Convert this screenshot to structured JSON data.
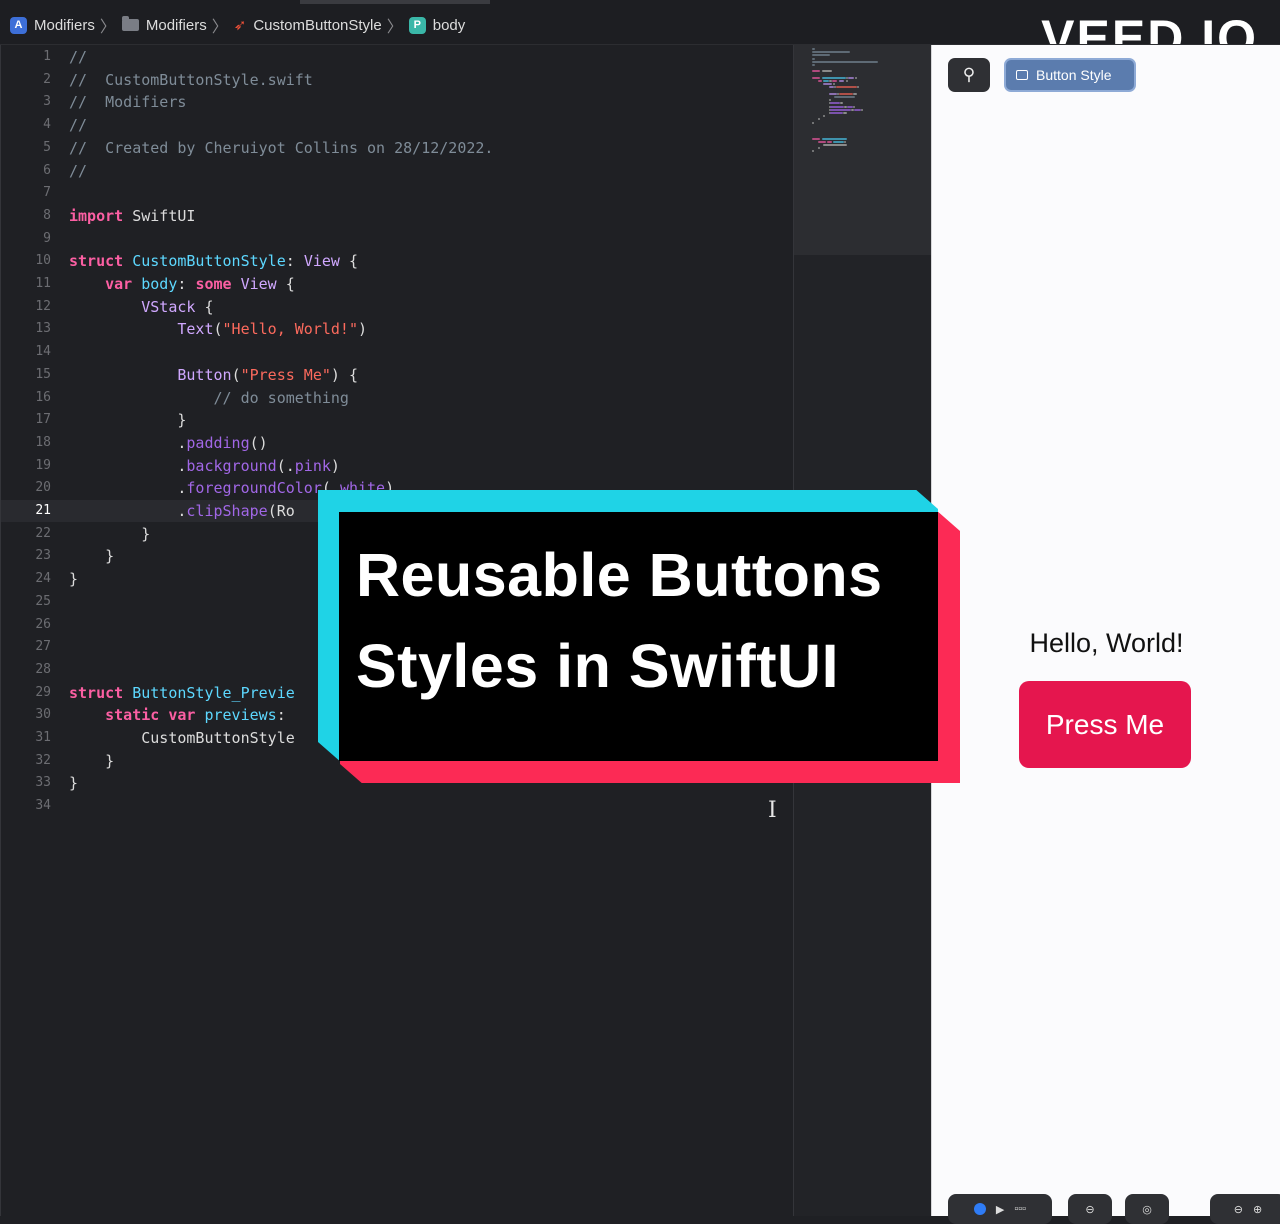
{
  "breadcrumb": {
    "items": [
      {
        "label": "Modifiers",
        "icon": "app-icon"
      },
      {
        "label": "Modifiers",
        "icon": "folder-icon"
      },
      {
        "label": "CustomButtonStyle",
        "icon": "swift-icon"
      },
      {
        "label": "body",
        "icon": "property-icon",
        "icon_letter": "P"
      }
    ]
  },
  "watermark": "VEED.IO",
  "editor": {
    "current_line": 21,
    "lines": [
      {
        "n": "1",
        "t": [
          [
            "c-com",
            "//"
          ]
        ]
      },
      {
        "n": "2",
        "t": [
          [
            "c-com",
            "//  CustomButtonStyle.swift"
          ]
        ]
      },
      {
        "n": "3",
        "t": [
          [
            "c-com",
            "//  Modifiers"
          ]
        ]
      },
      {
        "n": "4",
        "t": [
          [
            "c-com",
            "//"
          ]
        ]
      },
      {
        "n": "5",
        "t": [
          [
            "c-com",
            "//  Created by Cheruiyot Collins on 28/12/2022."
          ]
        ]
      },
      {
        "n": "6",
        "t": [
          [
            "c-com",
            "//"
          ]
        ]
      },
      {
        "n": "7",
        "t": []
      },
      {
        "n": "8",
        "t": [
          [
            "c-kw",
            "import"
          ],
          [
            "c-plain",
            " SwiftUI"
          ]
        ]
      },
      {
        "n": "9",
        "t": []
      },
      {
        "n": "10",
        "t": [
          [
            "c-kw",
            "struct"
          ],
          [
            "c-plain",
            " "
          ],
          [
            "c-type",
            "CustomButtonStyle"
          ],
          [
            "c-plain",
            ": "
          ],
          [
            "c-ty2",
            "View"
          ],
          [
            "c-plain",
            " {"
          ]
        ]
      },
      {
        "n": "11",
        "t": [
          [
            "c-plain",
            "    "
          ],
          [
            "c-kw",
            "var"
          ],
          [
            "c-plain",
            " "
          ],
          [
            "c-type",
            "body"
          ],
          [
            "c-plain",
            ": "
          ],
          [
            "c-kw",
            "some"
          ],
          [
            "c-plain",
            " "
          ],
          [
            "c-ty2",
            "View"
          ],
          [
            "c-plain",
            " {"
          ]
        ]
      },
      {
        "n": "12",
        "t": [
          [
            "c-plain",
            "        "
          ],
          [
            "c-ty2",
            "VStack"
          ],
          [
            "c-plain",
            " {"
          ]
        ]
      },
      {
        "n": "13",
        "t": [
          [
            "c-plain",
            "            "
          ],
          [
            "c-ty2",
            "Text"
          ],
          [
            "c-plain",
            "("
          ],
          [
            "c-str",
            "\"Hello, World!\""
          ],
          [
            "c-plain",
            ")"
          ]
        ]
      },
      {
        "n": "14",
        "t": []
      },
      {
        "n": "15",
        "t": [
          [
            "c-plain",
            "            "
          ],
          [
            "c-ty2",
            "Button"
          ],
          [
            "c-plain",
            "("
          ],
          [
            "c-str",
            "\"Press Me\""
          ],
          [
            "c-plain",
            ") {"
          ]
        ]
      },
      {
        "n": "16",
        "t": [
          [
            "c-plain",
            "                "
          ],
          [
            "c-com",
            "// do something"
          ]
        ]
      },
      {
        "n": "17",
        "t": [
          [
            "c-plain",
            "            }"
          ]
        ]
      },
      {
        "n": "18",
        "t": [
          [
            "c-plain",
            "            ."
          ],
          [
            "c-fn",
            "padding"
          ],
          [
            "c-plain",
            "()"
          ]
        ]
      },
      {
        "n": "19",
        "t": [
          [
            "c-plain",
            "            ."
          ],
          [
            "c-fn",
            "background"
          ],
          [
            "c-plain",
            "(."
          ],
          [
            "c-fn",
            "pink"
          ],
          [
            "c-plain",
            ")"
          ]
        ]
      },
      {
        "n": "20",
        "t": [
          [
            "c-plain",
            "            ."
          ],
          [
            "c-fn",
            "foregroundColor"
          ],
          [
            "c-plain",
            "(."
          ],
          [
            "c-fn",
            "white"
          ],
          [
            "c-plain",
            ")"
          ]
        ]
      },
      {
        "n": "21",
        "t": [
          [
            "c-plain",
            "            ."
          ],
          [
            "c-fn",
            "clipShape"
          ],
          [
            "c-plain",
            "(Ro"
          ]
        ]
      },
      {
        "n": "22",
        "t": [
          [
            "c-plain",
            "        }"
          ]
        ]
      },
      {
        "n": "23",
        "t": [
          [
            "c-plain",
            "    }"
          ]
        ]
      },
      {
        "n": "24",
        "t": [
          [
            "c-plain",
            "}"
          ]
        ]
      },
      {
        "n": "25",
        "t": []
      },
      {
        "n": "26",
        "t": []
      },
      {
        "n": "27",
        "t": []
      },
      {
        "n": "28",
        "t": []
      },
      {
        "n": "29",
        "t": [
          [
            "c-kw",
            "struct"
          ],
          [
            "c-plain",
            " "
          ],
          [
            "c-type",
            "ButtonStyle_Previe"
          ]
        ]
      },
      {
        "n": "30",
        "t": [
          [
            "c-plain",
            "    "
          ],
          [
            "c-kw",
            "static"
          ],
          [
            "c-plain",
            " "
          ],
          [
            "c-kw",
            "var"
          ],
          [
            "c-plain",
            " "
          ],
          [
            "c-type",
            "previews"
          ],
          [
            "c-plain",
            ":"
          ]
        ]
      },
      {
        "n": "31",
        "t": [
          [
            "c-plain",
            "        CustomButtonStyle"
          ]
        ]
      },
      {
        "n": "32",
        "t": [
          [
            "c-plain",
            "    }"
          ]
        ]
      },
      {
        "n": "33",
        "t": [
          [
            "c-plain",
            "}"
          ]
        ]
      },
      {
        "n": "34",
        "t": []
      }
    ]
  },
  "canvas": {
    "pin_icon": "pin-icon",
    "style_button_label": "Button Style",
    "hello_text": "Hello, World!",
    "press_button_label": "Press Me",
    "button_color": "#e5164e"
  },
  "overlay": {
    "title": "Reusable Buttons Styles in SwiftUI",
    "colors": {
      "left": "#1fd3e6",
      "right": "#fc2a55",
      "panel": "#000000"
    }
  }
}
